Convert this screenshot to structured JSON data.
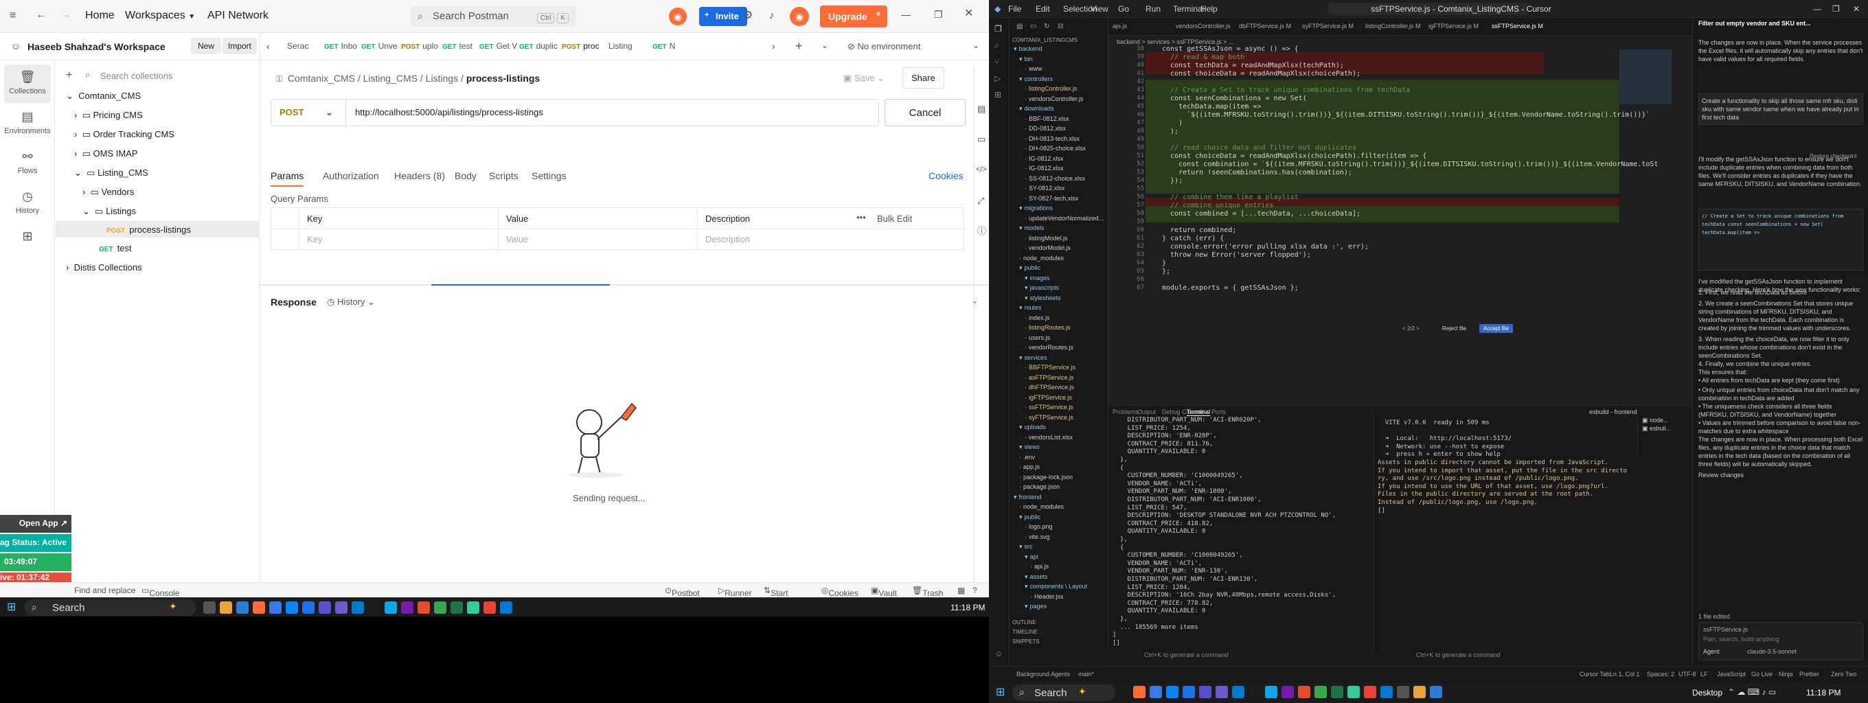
{
  "postman": {
    "nav": {
      "home": "Home",
      "workspaces": "Workspaces",
      "api_network": "API Network",
      "search": "Search Postman",
      "kbd1": "Ctrl",
      "kbd2": "K",
      "invite": "Invite",
      "upgrade": "Upgrade"
    },
    "workspace": {
      "name": "Haseeb Shahzad's Workspace",
      "new_btn": "New",
      "import_btn": "Import",
      "search_placeholder": "Search collections"
    },
    "rail": [
      "Collections",
      "Environments",
      "Flows",
      "History"
    ],
    "tree": {
      "root": "Comtanix_CMS",
      "pricing": "Pricing CMS",
      "order": "Order Tracking CMS",
      "oms": "OMS IMAP",
      "listing": "Listing_CMS",
      "vendors": "Vendors",
      "listings": "Listings",
      "req_method": "POST",
      "req_name": "process-listings",
      "test_method": "GET",
      "test_name": "test",
      "distis": "Distis Collections"
    },
    "tabs": [
      {
        "m": "",
        "t": "Serac"
      },
      {
        "m": "GET",
        "t": "Inbo"
      },
      {
        "m": "GET",
        "t": "Unve"
      },
      {
        "m": "POST",
        "t": "uplo"
      },
      {
        "m": "GET",
        "t": "test"
      },
      {
        "m": "GET",
        "t": "Get V"
      },
      {
        "m": "GET",
        "t": "duplic"
      },
      {
        "m": "POST",
        "t": "proc"
      },
      {
        "m": "",
        "t": "Listing"
      },
      {
        "m": "GET",
        "t": "N"
      }
    ],
    "env": "No environment",
    "breadcrumb": {
      "a": "Comtanix_CMS",
      "b": "Listing_CMS",
      "c": "Listings",
      "d": "process-listings"
    },
    "save": "Save",
    "share": "Share",
    "request": {
      "method": "POST",
      "url": "http://localhost:5000/api/listings/process-listings",
      "cancel": "Cancel"
    },
    "subtabs": [
      "Params",
      "Authorization",
      "Headers (8)",
      "Body",
      "Scripts",
      "Settings"
    ],
    "cookies": "Cookies",
    "query": {
      "title": "Query Params",
      "cols": [
        "Key",
        "Value",
        "Description"
      ],
      "bulk": "Bulk Edit",
      "ph": [
        "Key",
        "Value",
        "Description"
      ]
    },
    "response": {
      "title": "Response",
      "history": "History",
      "sending": "Sending request..."
    },
    "overlay": {
      "open": "Open App",
      "status": "ag Status: Active",
      "time1": "03:49:07",
      "time2": "ive: 01:37:42"
    },
    "status": [
      "Find and replace",
      "Console",
      "Postbot",
      "Runner",
      "Start Proxy",
      "Cookies",
      "Vault",
      "Trash"
    ]
  },
  "taskbar": {
    "search": "Search",
    "time": "11:18 PM"
  },
  "taskbar2": {
    "search": "Search",
    "desktop": "Desktop",
    "time": "11:18 PM"
  },
  "vscode": {
    "menus": [
      "File",
      "Edit",
      "Selection",
      "View",
      "Go",
      "Run",
      "Terminal",
      "Help"
    ],
    "title": "ssFTPService.js - Comtanix_ListingCMS - Cursor",
    "tabs": [
      "api.js",
      "vendorsController.js",
      "dbFTPService.js M",
      "syFTPService.js M",
      "listingController.js M",
      "igFTPService.js M",
      "ssFTPService.js M"
    ],
    "breadcrumb": "backend > services > ssFTPService.js > ...",
    "explorer": [
      {
        "t": "backend",
        "c": "f",
        "d": 0
      },
      {
        "t": "bin",
        "c": "f",
        "d": 1
      },
      {
        "t": "www",
        "c": "",
        "d": 2
      },
      {
        "t": "controllers",
        "c": "f",
        "d": 1
      },
      {
        "t": "listingController.js",
        "c": "m",
        "d": 2
      },
      {
        "t": "vendorsController.js",
        "c": "",
        "d": 2
      },
      {
        "t": "downloads",
        "c": "f",
        "d": 1
      },
      {
        "t": "BBF-0812.xlsx",
        "c": "",
        "d": 2
      },
      {
        "t": "DD-0812.xlsx",
        "c": "",
        "d": 2
      },
      {
        "t": "DH-0813-tech.xlsx",
        "c": "",
        "d": 2
      },
      {
        "t": "DH-0825-choice.xlsx",
        "c": "",
        "d": 2
      },
      {
        "t": "IG-0812.xlsx",
        "c": "",
        "d": 2
      },
      {
        "t": "IG-0812.xlsx",
        "c": "",
        "d": 2
      },
      {
        "t": "SS-0812-choice.xlsx",
        "c": "",
        "d": 2
      },
      {
        "t": "SY-0812.xlsx",
        "c": "",
        "d": 2
      },
      {
        "t": "SY-0827-tech.xlsx",
        "c": "",
        "d": 2
      },
      {
        "t": "migrations",
        "c": "f",
        "d": 1
      },
      {
        "t": "updateVendorNormalized...",
        "c": "",
        "d": 2
      },
      {
        "t": "models",
        "c": "f",
        "d": 1
      },
      {
        "t": "listingModel.js",
        "c": "",
        "d": 2
      },
      {
        "t": "vendorModel.js",
        "c": "",
        "d": 2
      },
      {
        "t": "node_modules",
        "c": "",
        "d": 1
      },
      {
        "t": "public",
        "c": "f",
        "d": 1
      },
      {
        "t": "images",
        "c": "f",
        "d": 2
      },
      {
        "t": "javascripts",
        "c": "f",
        "d": 2
      },
      {
        "t": "stylesheets",
        "c": "f",
        "d": 2
      },
      {
        "t": "routes",
        "c": "f",
        "d": 1
      },
      {
        "t": "index.js",
        "c": "",
        "d": 2
      },
      {
        "t": "listingRoutes.js",
        "c": "m",
        "d": 2
      },
      {
        "t": "users.js",
        "c": "",
        "d": 2
      },
      {
        "t": "vendorRoutes.js",
        "c": "",
        "d": 2
      },
      {
        "t": "services",
        "c": "f",
        "d": 1
      },
      {
        "t": "BBFTPService.js",
        "c": "m",
        "d": 2
      },
      {
        "t": "asFTPService.js",
        "c": "m",
        "d": 2
      },
      {
        "t": "dhFTPService.js",
        "c": "m",
        "d": 2
      },
      {
        "t": "igFTPService.js",
        "c": "m",
        "d": 2
      },
      {
        "t": "ssFTPService.js",
        "c": "m",
        "d": 2
      },
      {
        "t": "syFTPService.js",
        "c": "m",
        "d": 2
      },
      {
        "t": "uploads",
        "c": "f",
        "d": 1
      },
      {
        "t": "vendorsList.xlsx",
        "c": "",
        "d": 2
      },
      {
        "t": "views",
        "c": "f",
        "d": 1
      },
      {
        "t": ".env",
        "c": "",
        "d": 1
      },
      {
        "t": "app.js",
        "c": "",
        "d": 1
      },
      {
        "t": "package-lock.json",
        "c": "",
        "d": 1
      },
      {
        "t": "package.json",
        "c": "",
        "d": 1
      },
      {
        "t": "frontend",
        "c": "f",
        "d": 0
      },
      {
        "t": "node_modules",
        "c": "",
        "d": 1
      },
      {
        "t": "public",
        "c": "f",
        "d": 1
      },
      {
        "t": "logo.png",
        "c": "",
        "d": 2
      },
      {
        "t": "vite.svg",
        "c": "",
        "d": 2
      },
      {
        "t": "src",
        "c": "f",
        "d": 1
      },
      {
        "t": "api",
        "c": "f",
        "d": 2
      },
      {
        "t": "api.js",
        "c": "",
        "d": 3
      },
      {
        "t": "assets",
        "c": "f",
        "d": 2
      },
      {
        "t": "components \\ Layout",
        "c": "f",
        "d": 2
      },
      {
        "t": "Header.jsx",
        "c": "",
        "d": 3
      },
      {
        "t": "pages",
        "c": "f",
        "d": 2
      }
    ],
    "explorer_head": "COMTANIX_LISTINGCMS",
    "outline": "OUTLINE",
    "timeline": "TIMELINE",
    "snippets": "SNIPPETS",
    "code": [
      {
        "n": "38",
        "t": "const getSSAsJson = async () => {"
      },
      {
        "n": "39",
        "t": "  // read & map both"
      },
      {
        "n": "40",
        "t": "  const techData = readAndMapXlsx(techPath);"
      },
      {
        "n": "41",
        "t": "  const choiceData = readAndMapXlsx(choicePath);"
      },
      {
        "n": "42",
        "t": ""
      },
      {
        "n": "43",
        "t": "  // Create a Set to track unique combinations from techData"
      },
      {
        "n": "44",
        "t": "  const seenCombinations = new Set("
      },
      {
        "n": "45",
        "t": "    techData.map(item =>"
      },
      {
        "n": "46",
        "t": "      `${(item.MFRSKU.toString().trim())}_${(item.DITSISKU.toString().trim())}_${(item.VendorName.toString().trim())}`"
      },
      {
        "n": "47",
        "t": "    )"
      },
      {
        "n": "48",
        "t": "  );"
      },
      {
        "n": "49",
        "t": ""
      },
      {
        "n": "50",
        "t": "  // read choice data and filter out duplicates"
      },
      {
        "n": "51",
        "t": "  const choiceData = readAndMapXlsx(choicePath).filter(item => {"
      },
      {
        "n": "52",
        "t": "    const combination = `${(item.MFRSKU.toString().trim())}_${(item.DITSISKU.toString().trim())}_${(item.VendorName.toSt"
      },
      {
        "n": "53",
        "t": "    return !seenCombinations.has(combination);"
      },
      {
        "n": "54",
        "t": "  });"
      },
      {
        "n": "55",
        "t": ""
      },
      {
        "n": "56",
        "t": "  // combine them like a playlist"
      },
      {
        "n": "57",
        "t": "  // combine unique entries"
      },
      {
        "n": "58",
        "t": "  const combined = [...techData, ...choiceData];"
      },
      {
        "n": "59",
        "t": ""
      },
      {
        "n": "60",
        "t": "  return combined;"
      },
      {
        "n": "61",
        "t": "} catch (err) {"
      },
      {
        "n": "62",
        "t": "  console.error('error pulling xlsx data :', err);"
      },
      {
        "n": "63",
        "t": "  throw new Error('server flopped');"
      },
      {
        "n": "64",
        "t": "}"
      },
      {
        "n": "65",
        "t": "};"
      },
      {
        "n": "66",
        "t": ""
      },
      {
        "n": "67",
        "t": "module.exports = { getSSAsJson };"
      }
    ],
    "review": {
      "page": "< 2/2 >",
      "reject": "Reject file",
      "accept": "Accept file"
    },
    "term_tabs": [
      "Problems",
      "Output",
      "Debug Console",
      "Terminal",
      "Ports"
    ],
    "term_right": [
      "esbuild - frontend"
    ],
    "term_left": [
      "    DISTRIBUTOR_PART_NUM: 'ACI-ENR020P',",
      "    LIST_PRICE: 1254,",
      "    DESCRIPTION: 'ENR-020P',",
      "    CONTRACT_PRICE: 811.76,",
      "    QUANTITY_AVAILABLE: 0",
      "  },",
      "  {",
      "    CUSTOMER_NUMBER: 'C1000049265',",
      "    VENDOR_NAME: 'ACTi',",
      "    VENDOR_PART_NUM: 'ENR-1000',",
      "    DISTRIBUTOR_PART_NUM: 'ACI-ENR1000',",
      "    LIST_PRICE: 547,",
      "    DESCRIPTION: 'DESKTOP STANDALONE NVR ACH PTZCONTROL NO',",
      "    CONTRACT_PRICE: 418.82,",
      "    QUANTITY_AVAILABLE: 0",
      "  },",
      "  {",
      "    CUSTOMER_NUMBER: 'C1000049265',",
      "    VENDOR_NAME: 'ACTi',",
      "    VENDOR_PART_NUM: 'ENR-130',",
      "    DISTRIBUTOR_PART_NUM: 'ACI-ENR130',",
      "    LIST_PRICE: 1204,",
      "    DESCRIPTION: '16Ch 2bay NVR,40Mbps,remote access,Disks',",
      "    CONTRACT_PRICE: 778.82,",
      "    QUANTITY_AVAILABLE: 0",
      "  },",
      "  ... 185569 more items",
      "]",
      "[]"
    ],
    "term_vite": [
      "  VITE v7.0.0  ready in 509 ms",
      "",
      "  ➜  Local:   http://localhost:5173/",
      "  ➜  Network: use --host to expose",
      "  ➜  press h + enter to show help",
      "Assets in public directory cannot be imported from JavaScript.",
      "If you intend to import that asset, put the file in the src directo",
      "ry, and use /src/logo.png instead of /public/logo.png.",
      "If you intend to use the URL of that asset, use /logo.png?url.",
      "Files in the public directory are served at the root path.",
      "Instead of /public/logo.png, use /logo.png.",
      "[]"
    ],
    "term_hint": [
      "Ctrl+K to generate a command",
      "Ctrl+K to generate a command"
    ],
    "chat": [
      "Filter out empty vendor and SKU ent...",
      "The changes are now in place. When the service processes the Excel files, it will automatically skip any entries that don't have valid values for all required fields.",
      "Create a functionality to skip all those same mfr sku, disti sku with same vendor name when we have already put in first tech data",
      "I'll modify the getSSAsJson function to ensure we don't include duplicate entries when combining data from both files. We'll consider entries as duplicates if they have the same MFRSKU, DITSISKU, and VendorName combination.",
      "I've modified the getSSAsJson function to implement duplicate checking. Here's how the new functionality works:",
      "1. First, we read the techData as before",
      "2. We create a seenCombinations Set that stores unique string combinations of MFRSKU, DITSISKU, and VendorName from the techData. Each combination is created by joining the trimmed values with underscores.",
      "3. When reading the choiceData, we now filter it to only include entries whose combinations don't exist in the seenCombinations Set.",
      "4. Finally, we combine the unique entries.",
      "This ensures that:",
      "• All entries from techData are kept (they come first)",
      "• Only unique entries from choiceData that don't match any combination in techData are added",
      "• The uniqueness check considers all three fields (MFRSKU, DITSISKU, and VendorName) together",
      "• Values are trimmed before comparison to avoid false non-matches due to extra whitespace",
      "The changes are now in place. When processing both Excel files, any duplicate entries in the choice data that match entries in the tech data (based on the combination of all three fields) will be automatically skipped.",
      "Review changes"
    ],
    "chat_file": "ssFTPService.js",
    "chat_restore": "Restore checkpoint",
    "chat_input_ph": "Plan, search, build anything",
    "chat_agent": "Agent",
    "chat_model": "claude-3.5-sonnet",
    "chat_edited": "1 file edited",
    "status": {
      "left": "Background Agents",
      "branch": "main*",
      "pos": "Ln 1, Col 1",
      "spaces": "Spaces: 2",
      "enc": "UTF-8",
      "eol": "LF",
      "lang": "JavaScript",
      "live": "Go Live",
      "ninja": "Ninja",
      "tabs": "Cursor Tab",
      "prettier": "Prettier",
      "zoom": "Zero Two"
    }
  }
}
